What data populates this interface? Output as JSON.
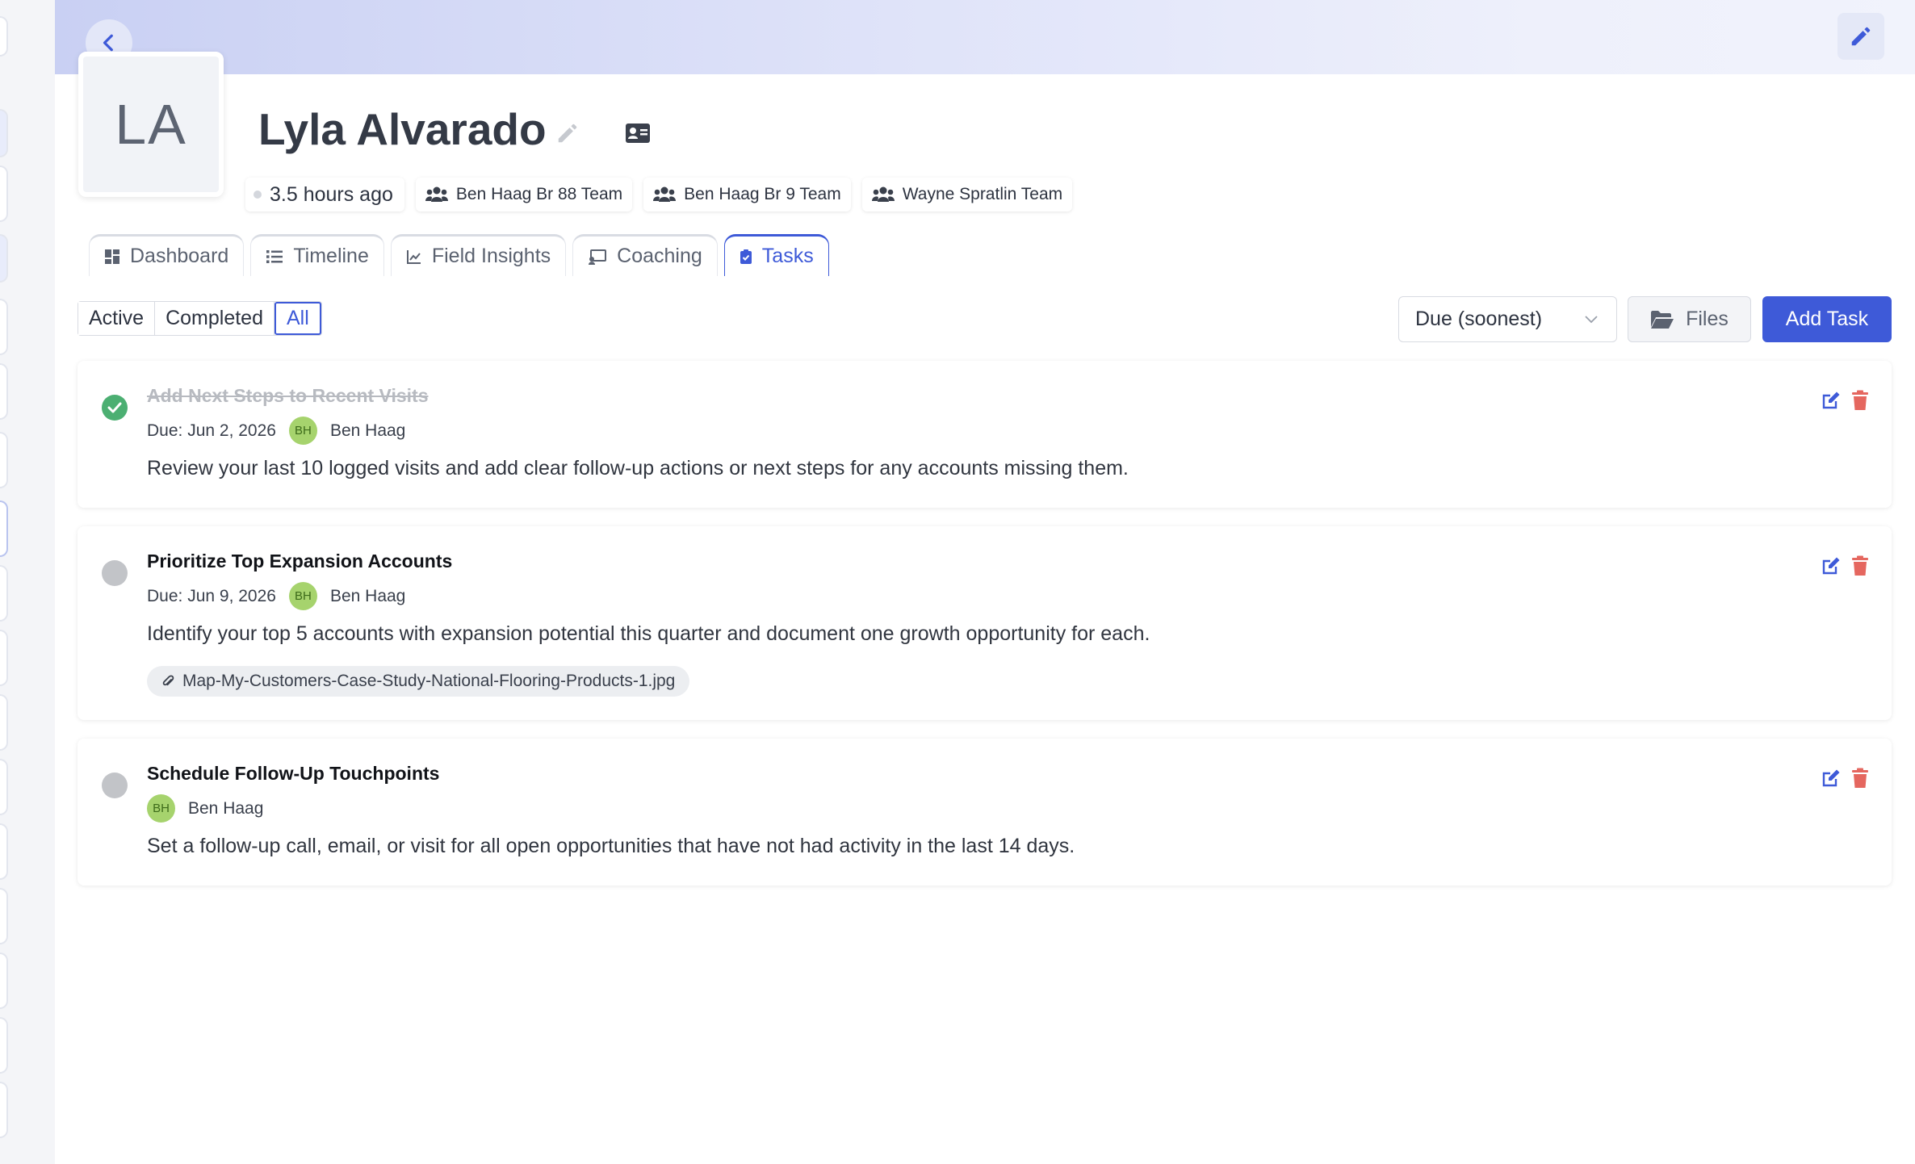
{
  "profile": {
    "initials": "LA",
    "name": "Lyla Alvarado",
    "last_active": "3.5 hours ago",
    "teams": [
      "Ben Haag Br 88 Team",
      "Ben Haag Br 9 Team",
      "Wayne Spratlin Team"
    ]
  },
  "tabs": [
    {
      "label": "Dashboard",
      "icon": "dashboard-icon"
    },
    {
      "label": "Timeline",
      "icon": "list-icon"
    },
    {
      "label": "Field Insights",
      "icon": "chart-line-icon"
    },
    {
      "label": "Coaching",
      "icon": "chalkboard-icon"
    },
    {
      "label": "Tasks",
      "icon": "clipboard-icon",
      "active": true
    }
  ],
  "filters": {
    "active": "Active",
    "completed": "Completed",
    "all": "All",
    "selected": "All"
  },
  "toolbar": {
    "sort_value": "Due (soonest)",
    "files_label": "Files",
    "add_task_label": "Add Task"
  },
  "tasks": [
    {
      "title": "Add Next Steps to Recent Visits",
      "completed": true,
      "due": "Due: Jun 2, 2026",
      "assignee_initials": "BH",
      "assignee": "Ben Haag",
      "description": "Review your last 10 logged visits and add clear follow-up actions or next steps for any accounts missing them."
    },
    {
      "title": "Prioritize Top Expansion Accounts",
      "completed": false,
      "due": "Due: Jun 9, 2026",
      "assignee_initials": "BH",
      "assignee": "Ben Haag",
      "description": "Identify your top 5 accounts with expansion potential this quarter and document one growth opportunity for each.",
      "attachment": "Map-My-Customers-Case-Study-National-Flooring-Products-1.jpg"
    },
    {
      "title": "Schedule Follow-Up Touchpoints",
      "completed": false,
      "assignee_initials": "BH",
      "assignee": "Ben Haag",
      "description": "Set a follow-up call, email, or visit for all open opportunities that have not had activity in the last 14 days."
    }
  ],
  "colors": {
    "accent": "#3e5ad8",
    "complete": "#4caf72",
    "delete": "#e5675f",
    "assignee_avatar": "#a6d36d"
  }
}
